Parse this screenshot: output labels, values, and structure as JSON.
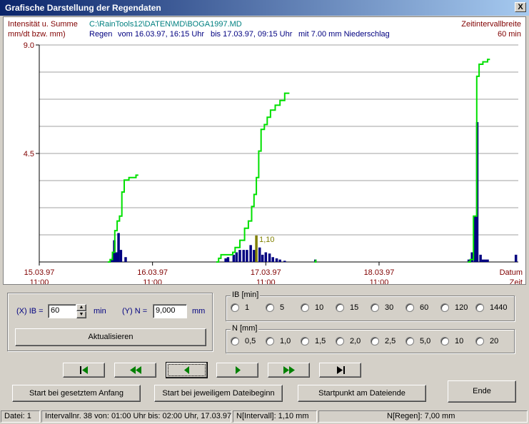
{
  "window": {
    "title": "Grafische Darstellung der Regendaten",
    "close_label": "X"
  },
  "chart_header": {
    "ylabel_line1": "Intensität u. Summe",
    "ylabel_line2": "mm/dt bzw. mm)",
    "file_path": "C:\\RainTools12\\DATEN\\MD\\BOGA1997.MD",
    "event_label": "Regen",
    "event_from": "vom 16.03.97, 16:15 Uhr",
    "event_to": "bis 17.03.97, 09:15 Uhr",
    "event_total": "mit  7.00 mm Niederschlag",
    "interval_line1": "Zeitintervallbreite",
    "interval_line2": "60 min",
    "xlabel_line1": "Datum",
    "xlabel_line2": "Zeit"
  },
  "chart_data": {
    "type": "bar",
    "y_ticks": [
      "9.0",
      "4.5"
    ],
    "ylim": [
      0,
      9
    ],
    "grid": true,
    "x_ticks": [
      {
        "date": "15.03.97",
        "time": "11:00"
      },
      {
        "date": "16.03.97",
        "time": "11:00"
      },
      {
        "date": "17.03.97",
        "time": "11:00"
      },
      {
        "date": "18.03.97",
        "time": "11:00"
      }
    ],
    "highlight_label": "1,10",
    "colors": {
      "bars": "#000080",
      "highlight_bar": "#808000",
      "cumulative": "#00e000",
      "grid": "#a0a0a0"
    },
    "series": [
      {
        "type": "bar",
        "values": [
          [
            15.3,
            0.1
          ],
          [
            15.6,
            0.2
          ],
          [
            15.9,
            0.9
          ],
          [
            16.3,
            0.4
          ],
          [
            16.8,
            1.2
          ],
          [
            17.3,
            0.5
          ],
          [
            18.3,
            0.2
          ],
          [
            39.5,
            0.15
          ],
          [
            40.0,
            0.2
          ],
          [
            41.2,
            0.3
          ],
          [
            41.8,
            0.4
          ],
          [
            42.5,
            0.5
          ],
          [
            43.3,
            0.5
          ],
          [
            44.0,
            0.5
          ],
          [
            44.8,
            0.7
          ],
          [
            45.5,
            0.5
          ],
          [
            46.0,
            1.1
          ],
          [
            46.7,
            0.6
          ],
          [
            47.3,
            0.3
          ],
          [
            48.0,
            0.4
          ],
          [
            48.8,
            0.35
          ],
          [
            49.5,
            0.2
          ],
          [
            50.3,
            0.15
          ],
          [
            51.0,
            0.1
          ],
          [
            52.0,
            0.05
          ],
          [
            58.5,
            0.1
          ],
          [
            91.0,
            0.1
          ],
          [
            91.7,
            0.4
          ],
          [
            92.3,
            1.9
          ],
          [
            92.8,
            5.8
          ],
          [
            93.5,
            0.3
          ],
          [
            94.0,
            0.1
          ],
          [
            94.5,
            0.1
          ],
          [
            95.0,
            0.1
          ],
          [
            101.0,
            0.3
          ]
        ]
      },
      {
        "type": "line",
        "values": [
          [
            14.5,
            0
          ],
          [
            15.0,
            0.1
          ],
          [
            15.5,
            0.4
          ],
          [
            16.0,
            1.3
          ],
          [
            16.5,
            1.7
          ],
          [
            17.0,
            1.9
          ],
          [
            17.5,
            2.9
          ],
          [
            18.0,
            3.4
          ],
          [
            19.0,
            3.5
          ],
          [
            20.0,
            3.5
          ],
          [
            20.5,
            3.6
          ],
          [
            21.0,
            3.6
          ],
          [
            37.5,
            0
          ],
          [
            38.0,
            0.15
          ],
          [
            38.5,
            0.3
          ],
          [
            41.0,
            0.4
          ],
          [
            41.5,
            0.6
          ],
          [
            42.5,
            0.9
          ],
          [
            43.5,
            1.4
          ],
          [
            44.3,
            1.7
          ],
          [
            45.0,
            2.3
          ],
          [
            45.5,
            2.8
          ],
          [
            46.0,
            3.5
          ],
          [
            46.5,
            4.6
          ],
          [
            47.0,
            5.5
          ],
          [
            47.7,
            5.7
          ],
          [
            48.3,
            6.0
          ],
          [
            49.0,
            6.3
          ],
          [
            50.0,
            6.5
          ],
          [
            51.0,
            6.7
          ],
          [
            52.0,
            7.0
          ],
          [
            53.0,
            7.0
          ],
          [
            58.3,
            0
          ],
          [
            58.6,
            0.1
          ],
          [
            59.0,
            0
          ],
          [
            90.8,
            0
          ],
          [
            91.3,
            0.1
          ],
          [
            92.0,
            1.9
          ],
          [
            92.7,
            7.7
          ],
          [
            93.2,
            8.2
          ],
          [
            94.0,
            8.3
          ],
          [
            95.0,
            8.4
          ],
          [
            95.5,
            8.4
          ]
        ]
      }
    ]
  },
  "ib_panel": {
    "x_label": "(X)  IB =",
    "ib_value": "60",
    "ib_unit": "min",
    "y_label": "(Y)  N =",
    "n_value": "9,000",
    "n_unit": "mm",
    "update_label": "Aktualisieren"
  },
  "ib_group": {
    "title": "IB [min]",
    "options": [
      "1",
      "5",
      "10",
      "15",
      "30",
      "60",
      "120",
      "1440"
    ]
  },
  "n_group": {
    "title": "N [mm]",
    "options": [
      "0,5",
      "1,0",
      "1,5",
      "2,0",
      "2,5",
      "5,0",
      "10",
      "20"
    ]
  },
  "nav": {
    "first_icon": "skip-first-icon",
    "fast_back_icon": "fast-backward-icon",
    "back_icon": "step-backward-icon",
    "forward_icon": "step-forward-icon",
    "fast_forward_icon": "fast-forward-icon",
    "last_icon": "skip-last-icon"
  },
  "buttons": {
    "start_set": "Start bei gesetztem Anfang",
    "start_file": "Start bei jeweiligem Dateibeginn",
    "start_end": "Startpunkt am Dateiende",
    "end": "Ende"
  },
  "status": {
    "file": "Datei: 1",
    "interval": "Intervallnr. 38 von: 01:00 Uhr bis: 02:00 Uhr, 17.03.97",
    "n_interval": "N[Intervall]:   1,10 mm",
    "n_event": "N[Regen]:   7,00 mm"
  }
}
